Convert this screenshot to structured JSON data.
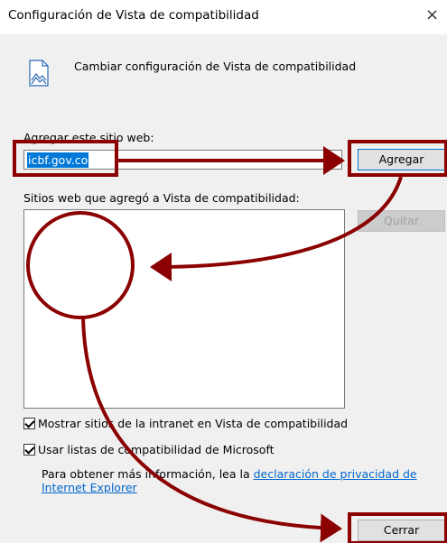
{
  "window": {
    "title": "Configuración de Vista de compatibilidad",
    "close_glyph": "×"
  },
  "header": {
    "icon": "compatibility-page-icon",
    "text": "Cambiar configuración de Vista de compatibilidad"
  },
  "add_site": {
    "label": "Agregar este sitio web:",
    "value": "icbf.gov.co",
    "button_label": "Agregar"
  },
  "site_list": {
    "label": "Sitios web que agregó a Vista de compatibilidad:",
    "items": [],
    "remove_label": "Quitar"
  },
  "options": {
    "intranet": {
      "label": "Mostrar sitios de la intranet en Vista de compatibilidad",
      "checked": true
    },
    "ms_lists": {
      "label": "Usar listas de compatibilidad de Microsoft",
      "checked": true
    }
  },
  "info": {
    "prefix": "Para obtener más información, lea la ",
    "link_label": "declaración de privacidad de Internet Explorer"
  },
  "footer": {
    "close_label": "Cerrar"
  },
  "colors": {
    "accent": "#0078d7",
    "annotation": "#8b0000",
    "link": "#0066cc"
  }
}
